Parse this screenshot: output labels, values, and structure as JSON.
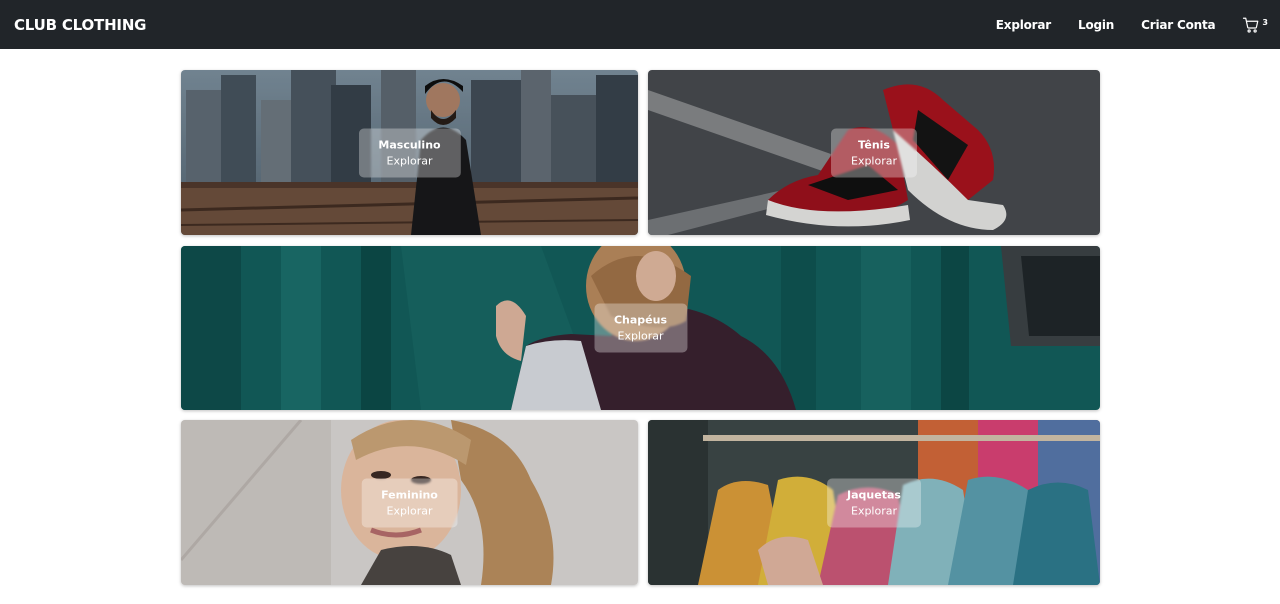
{
  "navbar": {
    "brand": "CLUB CLOTHING",
    "links": [
      "Explorar",
      "Login",
      "Criar Conta"
    ],
    "cart_icon": "shopping-cart-icon",
    "cart_count": "3"
  },
  "categories": [
    {
      "title": "Masculino",
      "cta": "Explorar"
    },
    {
      "title": "Tênis",
      "cta": "Explorar"
    },
    {
      "title": "Chapéus",
      "cta": "Explorar"
    },
    {
      "title": "Feminino",
      "cta": "Explorar"
    },
    {
      "title": "Jaquetas",
      "cta": "Explorar"
    }
  ]
}
